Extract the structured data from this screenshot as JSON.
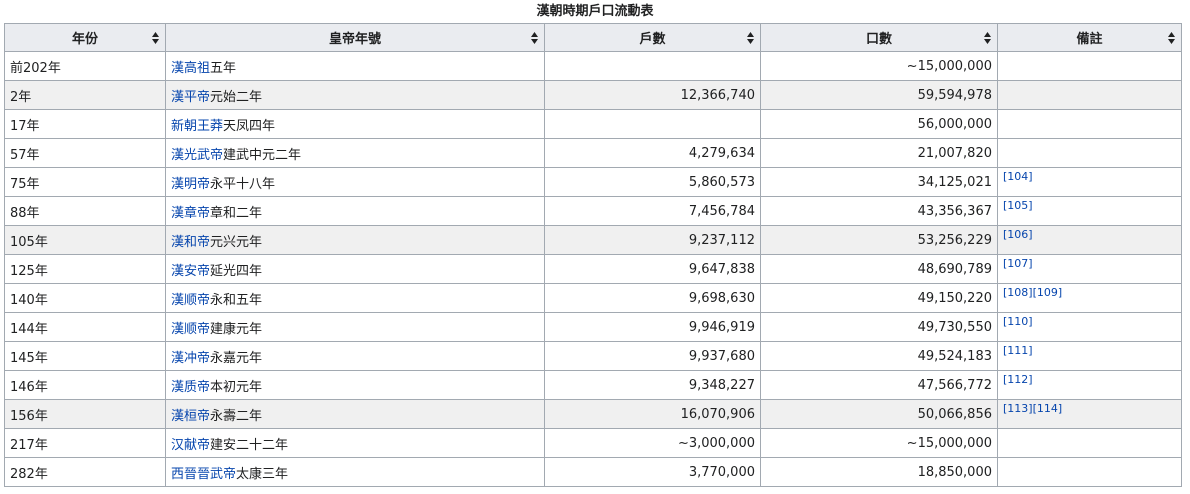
{
  "caption": "漢朝時期戶口流動表",
  "headers": [
    "年份",
    "皇帝年號",
    "戶數",
    "口數",
    "備註"
  ],
  "rows": [
    {
      "year": "前202年",
      "emperor": "漢高祖",
      "era": "五年",
      "households": "",
      "population": "~15,000,000",
      "refs": "",
      "alt": false
    },
    {
      "year": "2年",
      "emperor": "漢平帝",
      "era": "元始二年",
      "households": "12,366,740",
      "population": "59,594,978",
      "refs": "",
      "alt": true
    },
    {
      "year": "17年",
      "emperor": "新朝王莽",
      "era": "天凤四年",
      "households": "",
      "population": "56,000,000",
      "refs": "",
      "alt": false
    },
    {
      "year": "57年",
      "emperor": "漢光武帝",
      "era": "建武中元二年",
      "households": "4,279,634",
      "population": "21,007,820",
      "refs": "",
      "alt": false
    },
    {
      "year": "75年",
      "emperor": "漢明帝",
      "era": "永平十八年",
      "households": "5,860,573",
      "population": "34,125,021",
      "refs": "[104]",
      "alt": false
    },
    {
      "year": "88年",
      "emperor": "漢章帝",
      "era": "章和二年",
      "households": "7,456,784",
      "population": "43,356,367",
      "refs": "[105]",
      "alt": false
    },
    {
      "year": "105年",
      "emperor": "漢和帝",
      "era": "元兴元年",
      "households": "9,237,112",
      "population": "53,256,229",
      "refs": "[106]",
      "alt": true
    },
    {
      "year": "125年",
      "emperor": "漢安帝",
      "era": "延光四年",
      "households": "9,647,838",
      "population": "48,690,789",
      "refs": "[107]",
      "alt": false
    },
    {
      "year": "140年",
      "emperor": "漢顺帝",
      "era": "永和五年",
      "households": "9,698,630",
      "population": "49,150,220",
      "refs": "[108][109]",
      "alt": false
    },
    {
      "year": "144年",
      "emperor": "漢顺帝",
      "era": "建康元年",
      "households": "9,946,919",
      "population": "49,730,550",
      "refs": "[110]",
      "alt": false
    },
    {
      "year": "145年",
      "emperor": "漢冲帝",
      "era": "永嘉元年",
      "households": "9,937,680",
      "population": "49,524,183",
      "refs": "[111]",
      "alt": false
    },
    {
      "year": "146年",
      "emperor": "漢质帝",
      "era": "本初元年",
      "households": "9,348,227",
      "population": "47,566,772",
      "refs": "[112]",
      "alt": false
    },
    {
      "year": "156年",
      "emperor": "漢桓帝",
      "era": "永壽二年",
      "households": "16,070,906",
      "population": "50,066,856",
      "refs": "[113][114]",
      "alt": true
    },
    {
      "year": "217年",
      "emperor": "汉献帝",
      "era": "建安二十二年",
      "households": "~3,000,000",
      "population": "~15,000,000",
      "refs": "",
      "alt": false
    },
    {
      "year": "282年",
      "emperor": "西晉晉武帝",
      "era": "太康三年",
      "households": "3,770,000",
      "population": "18,850,000",
      "refs": "",
      "alt": false
    }
  ],
  "colors": {
    "link": "#0645ad",
    "header_bg": "#eaecf0",
    "border": "#a2a9b1",
    "alt_row": "#f0f0f0"
  }
}
